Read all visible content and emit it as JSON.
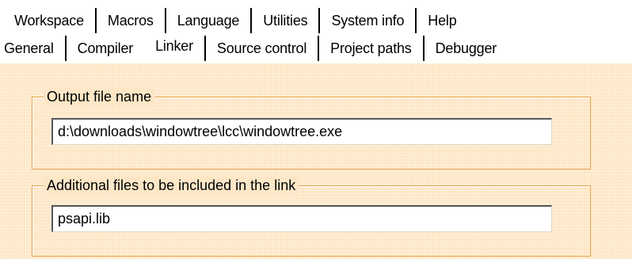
{
  "tabs": {
    "top_row": [
      {
        "label": "Workspace"
      },
      {
        "label": "Macros"
      },
      {
        "label": "Language"
      },
      {
        "label": "Utilities"
      },
      {
        "label": "System info"
      },
      {
        "label": "Help"
      }
    ],
    "bottom_row": [
      {
        "label": "General"
      },
      {
        "label": "Compiler"
      },
      {
        "label": "Linker",
        "selected": true
      },
      {
        "label": "Source control"
      },
      {
        "label": "Project paths"
      },
      {
        "label": "Debugger"
      }
    ]
  },
  "linker": {
    "output_file": {
      "label": "Output file name",
      "value": "d:\\downloads\\windowtree\\lcc\\windowtree.exe"
    },
    "additional_files": {
      "label": "Additional files to be included in the link",
      "value": "psapi.lib"
    }
  },
  "colors": {
    "panel_background": "#fde7c7",
    "groupbox_border": "#e8a146",
    "field_background": "#ffffff"
  }
}
